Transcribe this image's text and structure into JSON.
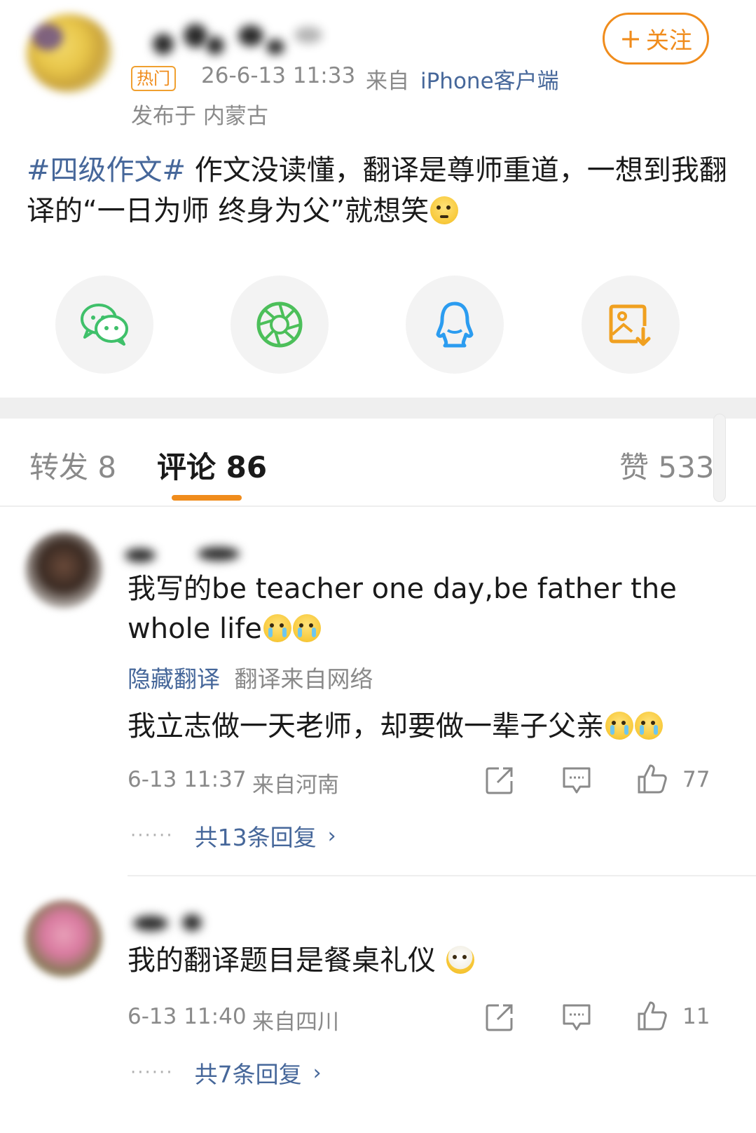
{
  "post": {
    "hot_badge": "热门",
    "time": "26-6-13 11:33",
    "from_prefix": "来自",
    "device": "iPhone客户端",
    "location": "发布于 内蒙古",
    "follow_label": "关注",
    "follow_plus": "+",
    "hashtag": "#四级作文#",
    "text": "作文没读懂，翻译是尊师重道，一想到我翻译的“一日为师 终身为父”就想笑"
  },
  "share": [
    {
      "icon": "wechat-icon",
      "color": "#3fc06a"
    },
    {
      "icon": "moments-icon",
      "color": "#4cbf5a"
    },
    {
      "icon": "qq-icon",
      "color": "#2b9cf0"
    },
    {
      "icon": "save-image-icon",
      "color": "#f0a020"
    }
  ],
  "tabs": {
    "repost": "转发 8",
    "comments": "评论 86",
    "likes": "赞 533"
  },
  "comments": [
    {
      "text": "我写的be teacher one day,be father the whole life",
      "hide_translation": "隐藏翻译",
      "translation_source": "翻译来自网络",
      "translation": "我立志做一天老师，却要做一辈子父亲",
      "time": "6-13 11:37",
      "location": "来自河南",
      "like_count": "77",
      "replies": "共13条回复"
    },
    {
      "text": "我的翻译题目是餐桌礼仪",
      "time": "6-13 11:40",
      "location": "来自四川",
      "like_count": "11",
      "replies": "共7条回复"
    }
  ],
  "colors": {
    "accent": "#f08c1c",
    "link": "#46679a",
    "muted": "#8a8a8a"
  }
}
